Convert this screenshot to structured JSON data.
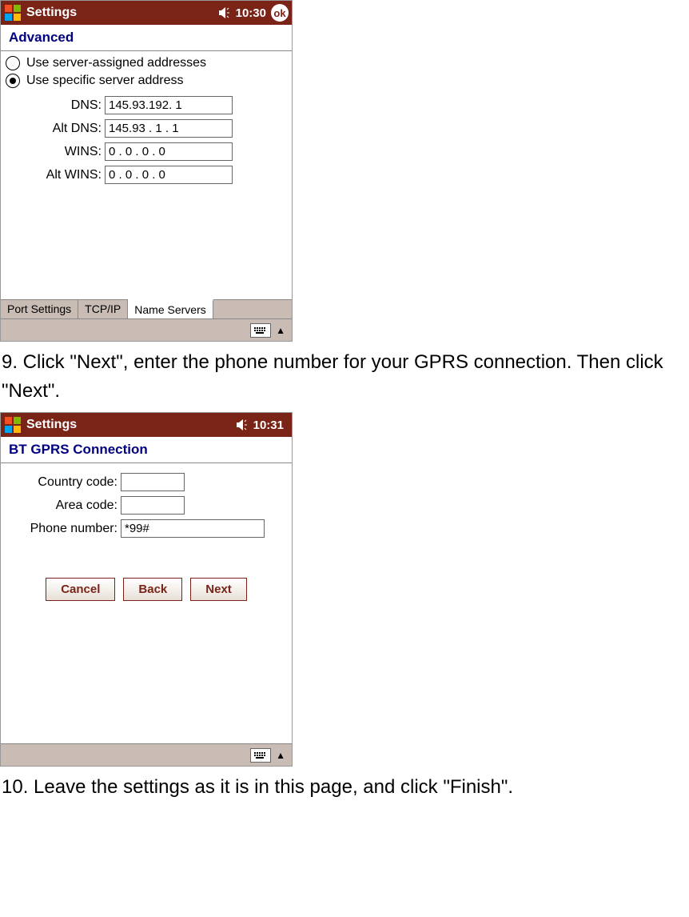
{
  "screenshot1": {
    "titlebar": {
      "title": "Settings",
      "time": "10:30",
      "ok": "ok"
    },
    "section": "Advanced",
    "radios": {
      "serverAssigned": "Use server-assigned addresses",
      "specific": "Use specific server address"
    },
    "selectedRadio": "specific",
    "fields": {
      "dns": {
        "label": "DNS:",
        "value": "145.93.192. 1"
      },
      "altdns": {
        "label": "Alt DNS:",
        "value": "145.93 . 1 . 1"
      },
      "wins": {
        "label": "WINS:",
        "value": "0 . 0 . 0 . 0"
      },
      "altwins": {
        "label": "Alt WINS:",
        "value": "0 . 0 . 0 . 0"
      }
    },
    "tabs": {
      "port": "Port Settings",
      "tcpip": "TCP/IP",
      "ns": "Name Servers"
    }
  },
  "instruction1": "9. Click \"Next\", enter the phone number for your GPRS connection. Then click \"Next\".",
  "screenshot2": {
    "titlebar": {
      "title": "Settings",
      "time": "10:31"
    },
    "section": "BT GPRS Connection",
    "fields": {
      "country": {
        "label": "Country code:",
        "value": ""
      },
      "area": {
        "label": "Area code:",
        "value": ""
      },
      "phone": {
        "label": "Phone number:",
        "value": "*99#"
      }
    },
    "buttons": {
      "cancel": "Cancel",
      "back": "Back",
      "next": "Next"
    }
  },
  "instruction2": "10. Leave the settings as it is in this page, and click \"Finish\"."
}
